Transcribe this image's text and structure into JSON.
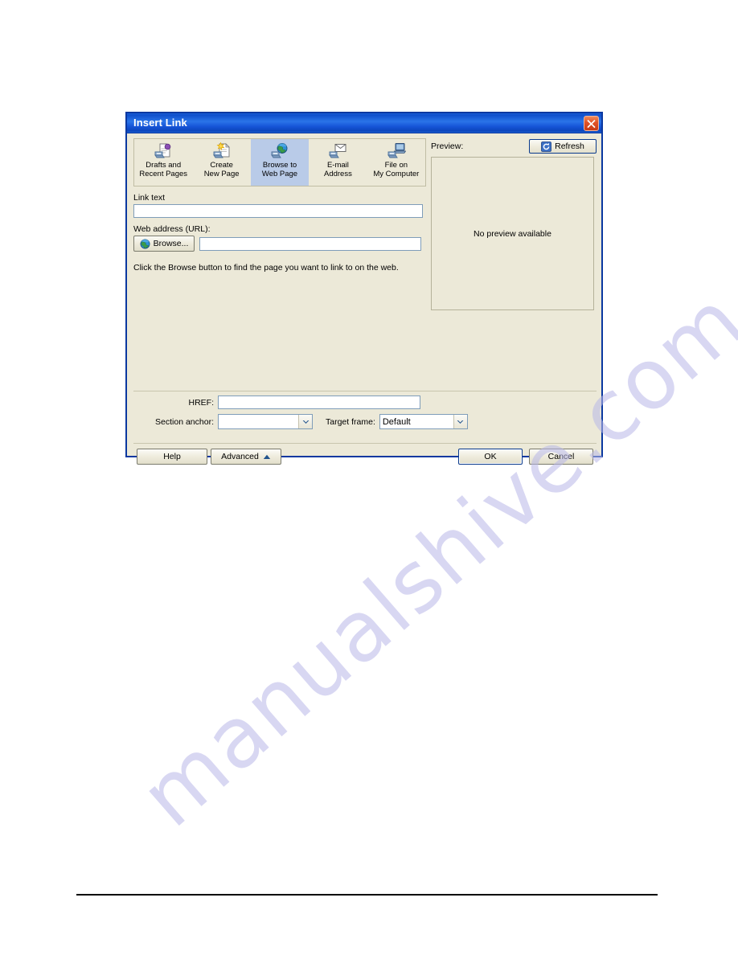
{
  "page": {
    "watermark": "manualshive.com"
  },
  "dialog": {
    "title": "Insert Link",
    "close_icon_name": "close-icon",
    "link_types": [
      {
        "label": "Drafts and\nRecent Pages",
        "icon": "drafts-recent-pages-icon",
        "selected": false
      },
      {
        "label": "Create\nNew Page",
        "icon": "create-new-page-icon",
        "selected": false
      },
      {
        "label": "Browse to\nWeb Page",
        "icon": "browse-web-page-icon",
        "selected": true
      },
      {
        "label": "E-mail\nAddress",
        "icon": "email-address-icon",
        "selected": false
      },
      {
        "label": "File on\nMy Computer",
        "icon": "file-on-my-computer-icon",
        "selected": false
      }
    ],
    "link_text": {
      "label": "Link text",
      "value": "",
      "placeholder": ""
    },
    "web_address": {
      "label": "Web address (URL):",
      "browse_label": "Browse...",
      "value": "",
      "placeholder": ""
    },
    "hint": "Click the Browse button to find the page you want to link to on the web.",
    "preview": {
      "label": "Preview:",
      "refresh_label": "Refresh",
      "refresh_icon": "refresh-icon",
      "empty_message": "No preview available"
    },
    "advanced": {
      "href_label": "HREF:",
      "href_value": "",
      "section_anchor_label": "Section anchor:",
      "section_anchor_value": "",
      "target_frame_label": "Target frame:",
      "target_frame_value": "Default"
    },
    "buttons": {
      "help": "Help",
      "advanced": "Advanced",
      "advanced_arrow_icon": "triangle-up-icon",
      "ok": "OK",
      "cancel": "Cancel"
    },
    "colors": {
      "title_bar": "#1553d6",
      "dialog_face": "#ece9d8",
      "selection": "#b9cbe8",
      "field_border": "#7f9db9",
      "close_button": "#c93a14",
      "watermark": "#b9b8e8"
    }
  }
}
